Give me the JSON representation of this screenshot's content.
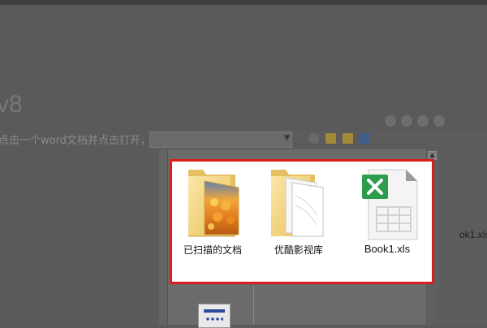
{
  "background": {
    "title": "v8",
    "instruction": "点击一个word文档并点击打开，如下图",
    "tick": "'"
  },
  "files": [
    {
      "name": "已扫描的文档",
      "icon": "scanned-documents-folder-icon"
    },
    {
      "name": "优酷影视库",
      "icon": "folder-icon"
    },
    {
      "name": "Book1.xls",
      "icon": "excel-file-icon"
    }
  ],
  "partial": {
    "right_label": "ok1.xls"
  },
  "colors": {
    "highlight_border": "#dd1c1c",
    "excel_green": "#2e9c4d",
    "folder_yellow": "#f3d67a"
  }
}
